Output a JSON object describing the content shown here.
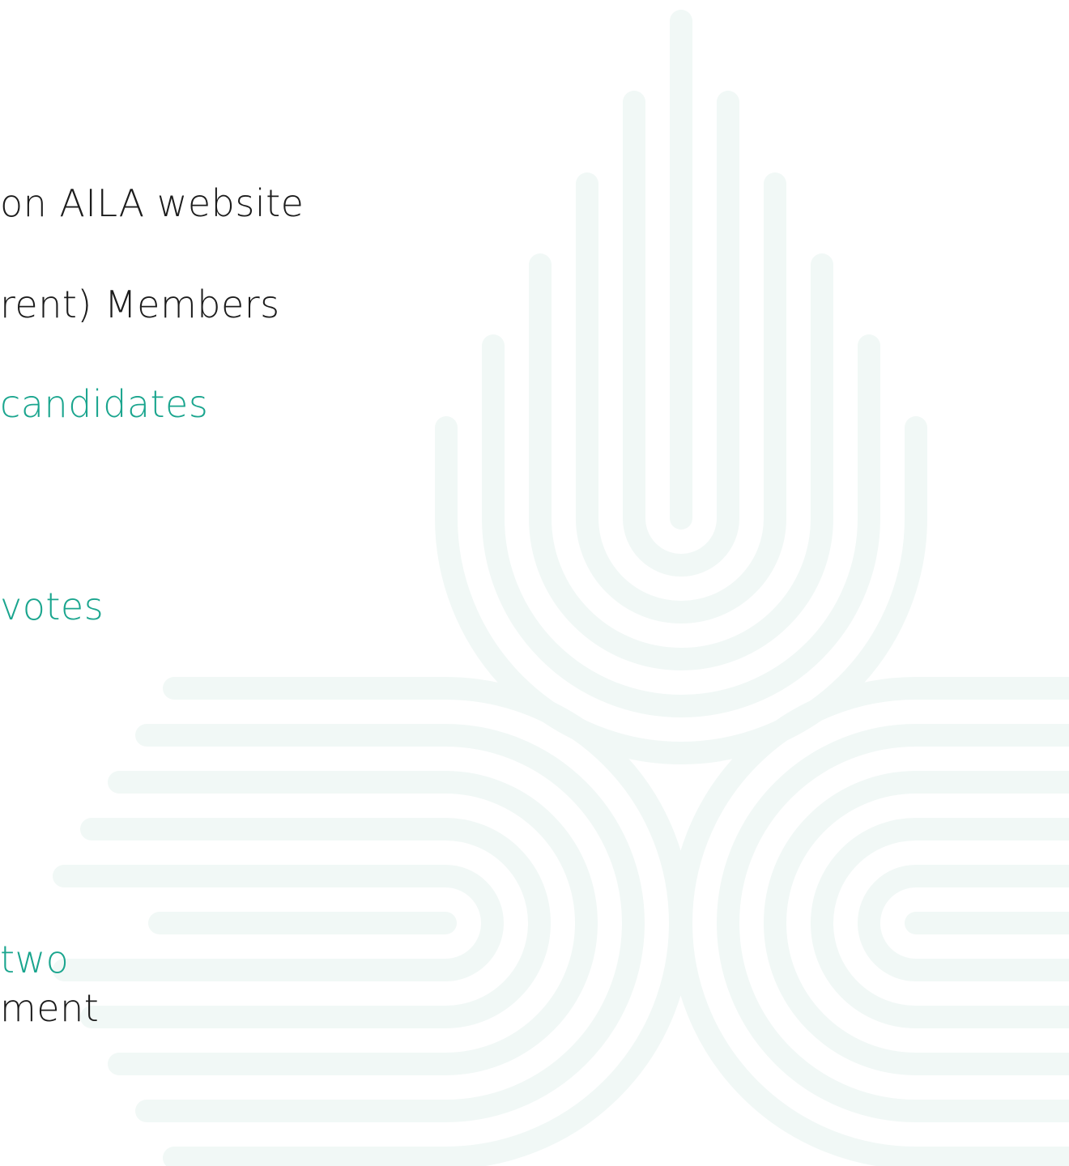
{
  "colors": {
    "background": "#ffffff",
    "text": "#1c1c1c",
    "accent": "#1aa58e",
    "watermark": "#f1f8f6"
  },
  "lines": [
    {
      "text": "on AILA website",
      "tone": "dark"
    },
    {
      "text": "rent) Members",
      "tone": "dark"
    },
    {
      "text": " candidates",
      "tone": "accent"
    },
    {
      "text": "votes",
      "tone": "accent"
    },
    {
      "text": "two",
      "tone": "accent"
    },
    {
      "text": "ment",
      "tone": "dark"
    }
  ],
  "watermark": {
    "icon": "three-petal-logo-watermark-icon"
  }
}
